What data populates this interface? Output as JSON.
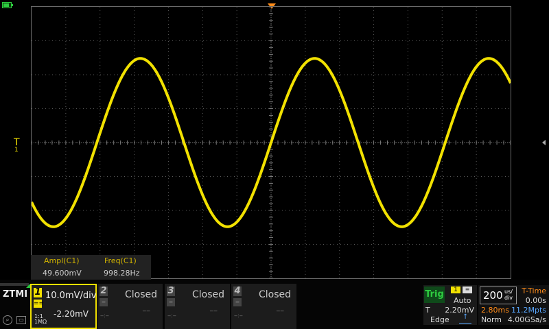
{
  "status": {
    "battery_icon": "battery-icon"
  },
  "colors": {
    "ch1": "#f2e100",
    "trigger_marker": "#ff8c1a",
    "grid": "#5a5a5a",
    "accent_green": "#2ecc40",
    "accent_blue": "#5aa8ff"
  },
  "trigger_marker": {
    "label": "T",
    "ch_label": "1"
  },
  "waveform": {
    "channel": "1",
    "shape": "sine",
    "cycles_visible": 2.75,
    "amplitude_div": 2.48,
    "offset_div": 0
  },
  "measurements": {
    "ampl_label": "Ampl(C1)",
    "ampl_value": "49.600mV",
    "freq_label": "Freq(C1)",
    "freq_value": "998.28Hz"
  },
  "brand": {
    "logo": "ZTMI"
  },
  "channels": [
    {
      "num": "1",
      "sub": "==",
      "scale": "10.0mV/div",
      "offset": "-2.20mV",
      "coupling": "1:1\n1MΩ"
    },
    {
      "num": "2",
      "sub": "‒",
      "status": "Closed",
      "dash1": "‒:‒",
      "dash2": "‒‒"
    },
    {
      "num": "3",
      "sub": "‒",
      "status": "Closed",
      "dash1": "‒:‒",
      "dash2": "‒‒"
    },
    {
      "num": "4",
      "sub": "‒",
      "status": "Closed",
      "dash1": "‒:‒",
      "dash2": "‒‒"
    }
  ],
  "trigger": {
    "label": "Trig",
    "source": "1",
    "coupling_icon": "dc-coupling-icon",
    "mode": "Auto",
    "t_label": "T",
    "level": "2.20mV",
    "type": "Edge",
    "edge_icon": "rising-edge-icon"
  },
  "timebase": {
    "value": "200",
    "unit_top": "us/",
    "unit_bottom": "div",
    "ttime_label": "T-Time",
    "ttime_value": "0.00s",
    "length": "2.80ms",
    "memory_depth": "11.2Mpts",
    "acq_mode": "Norm",
    "sample_rate": "4.00GSa/s"
  }
}
